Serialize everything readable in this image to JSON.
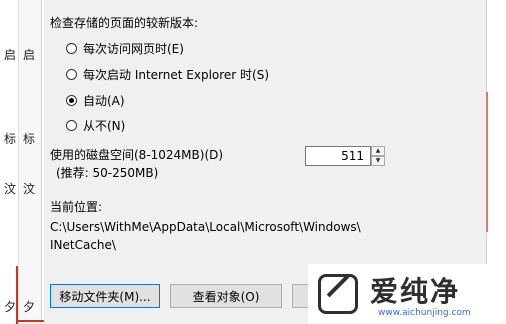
{
  "cache_settings": {
    "heading": "检查存储的页面的较新版本:",
    "options": [
      {
        "label": "每次访问网页时(E)",
        "checked": false
      },
      {
        "label": "每次启动 Internet Explorer 时(S)",
        "checked": false
      },
      {
        "label": "自动(A)",
        "checked": true
      },
      {
        "label": "从不(N)",
        "checked": false
      }
    ],
    "disk_space_label": "使用的磁盘空间(8-1024MB)(D)",
    "disk_space_recommend": "(推荐: 50-250MB)",
    "disk_space_value": "511",
    "current_location_label": "当前位置:",
    "current_location_line1": "C:\\Users\\WithMe\\AppData\\Local\\Microsoft\\Windows\\",
    "current_location_line2": "INetCache\\",
    "buttons": {
      "move_folder": "移动文件夹(M)...",
      "view_objects": "查看对象(O)"
    }
  },
  "background_side_glyphs": {
    "left_col1": [
      "启",
      "标",
      "汶"
    ],
    "left_col2": [
      "启",
      "标",
      "汶"
    ],
    "bottom_left": [
      "夕",
      "夕"
    ]
  },
  "watermark": {
    "brand": "爱纯净",
    "url": "www.aichunjing.com"
  },
  "colors": {
    "window_bg": "#f0f0f0",
    "button_bg": "#e1e1e1",
    "focus_border": "#0078d7",
    "frame_accent": "#c8382a",
    "watermark_url": "#2f6fd6"
  }
}
